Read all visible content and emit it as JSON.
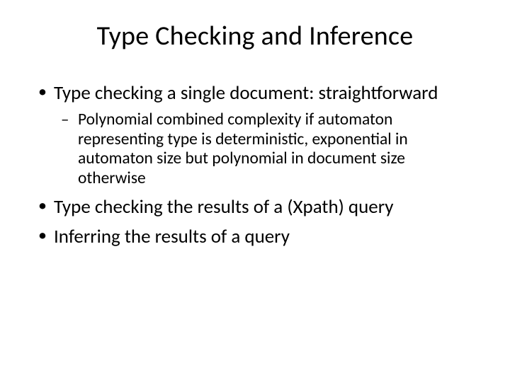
{
  "title": "Type Checking and Inference",
  "bullets": {
    "b1": "Type checking a single document: straightforward",
    "b1_sub1": "Polynomial combined complexity if automaton representing type is deterministic, exponential in automaton size but polynomial in document size otherwise",
    "b2": "Type checking the results of a (Xpath) query",
    "b3": "Inferring the results of a query"
  }
}
